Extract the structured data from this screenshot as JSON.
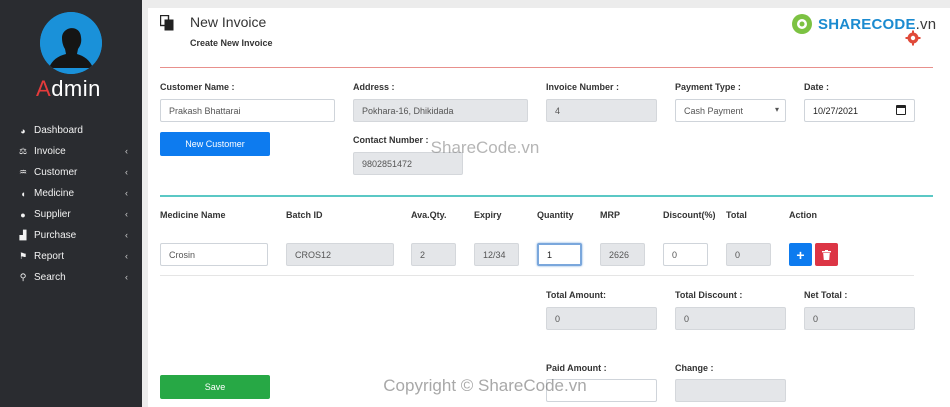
{
  "sidebar": {
    "brand_first": "A",
    "brand_rest": "dmin",
    "items": [
      {
        "label": "Dashboard",
        "icon": "dashboard-icon",
        "has_chevron": false
      },
      {
        "label": "Invoice",
        "icon": "scale-icon",
        "has_chevron": true
      },
      {
        "label": "Customer",
        "icon": "handshake-icon",
        "has_chevron": true
      },
      {
        "label": "Medicine",
        "icon": "capsule-icon",
        "has_chevron": true
      },
      {
        "label": "Supplier",
        "icon": "users-icon",
        "has_chevron": true
      },
      {
        "label": "Purchase",
        "icon": "bar-chart-icon",
        "has_chevron": true
      },
      {
        "label": "Report",
        "icon": "flag-icon",
        "has_chevron": true
      },
      {
        "label": "Search",
        "icon": "search-icon",
        "has_chevron": true
      }
    ],
    "chevron": "‹"
  },
  "header": {
    "title": "New Invoice",
    "subtitle": "Create New Invoice"
  },
  "customer": {
    "name_label": "Customer Name :",
    "name_value": "Prakash Bhattarai",
    "new_customer_button": "New Customer",
    "address_label": "Address :",
    "address_value": "Pokhara-16, Dhikidada",
    "contact_label": "Contact Number :",
    "contact_value": "9802851472",
    "invoice_number_label": "Invoice Number :",
    "invoice_number_value": "4",
    "payment_type_label": "Payment Type :",
    "payment_type_value": "Cash Payment",
    "date_label": "Date :",
    "date_value": "10/27/2021"
  },
  "medicine_table": {
    "headers": [
      "Medicine Name",
      "Batch ID",
      "Ava.Qty.",
      "Expiry",
      "Quantity",
      "MRP",
      "Discount(%)",
      "Total",
      "Action"
    ],
    "row": {
      "name": "Crosin",
      "batch_id": "CROS12",
      "ava_qty": "2",
      "expiry": "12/34",
      "quantity": "1",
      "mrp": "2626",
      "discount": "0",
      "total": "0"
    },
    "add_glyph": "+",
    "delete_glyph": "🗑"
  },
  "totals": {
    "total_amount_label": "Total Amount:",
    "total_amount_value": "0",
    "total_discount_label": "Total Discount :",
    "total_discount_value": "0",
    "net_total_label": "Net Total :",
    "net_total_value": "0",
    "paid_amount_label": "Paid Amount :",
    "paid_amount_value": "",
    "change_label": "Change :",
    "change_value": ""
  },
  "save_button": "Save",
  "watermark": {
    "logo_main": "SHARECODE",
    "logo_domain": ".vn",
    "center_text": "ShareCode.vn",
    "bottom_text": "Copyright © ShareCode.vn"
  },
  "colors": {
    "sidebar_bg": "#2a2c30",
    "accent_blue": "#0d7bef",
    "save_green": "#27a845",
    "delete_red": "#dc3545",
    "divider_red": "#e8908c",
    "divider_teal": "#5bc8c5"
  }
}
